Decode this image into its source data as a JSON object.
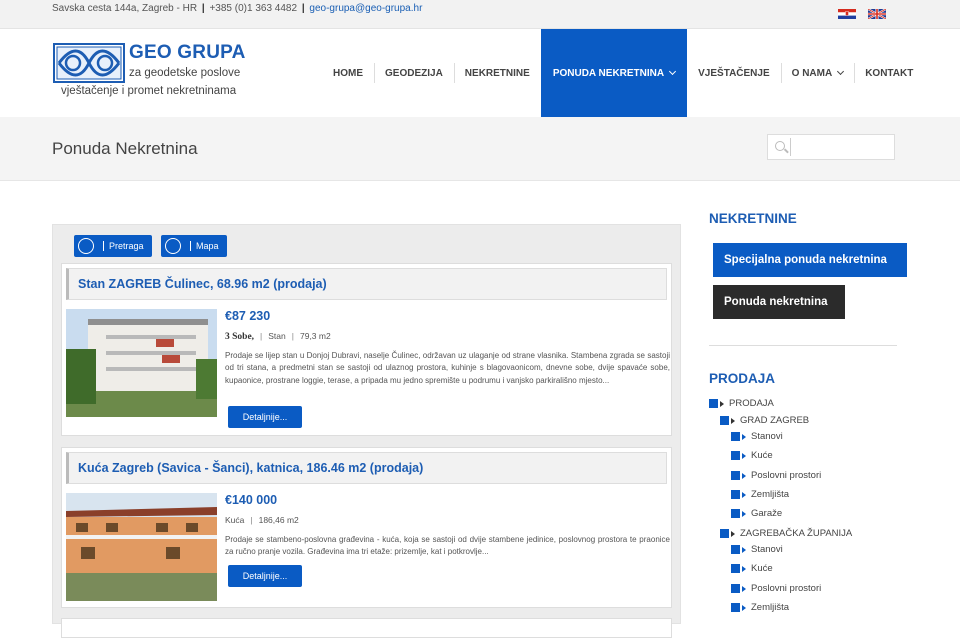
{
  "topbar": {
    "address": "Savska cesta 144a, Zagreb - HR",
    "phone": "+385 (0)1 363 4482",
    "email": "geo-grupa@geo-grupa.hr"
  },
  "logo": {
    "name": "GEO GRUPA",
    "tagline1": "za geodetske poslove",
    "tagline2": "vještačenje i promet nekretninama"
  },
  "nav": {
    "items": [
      {
        "label": "HOME"
      },
      {
        "label": "GEODEZIJA"
      },
      {
        "label": "NEKRETNINE"
      },
      {
        "label": "PONUDA NEKRETNINA"
      },
      {
        "label": "VJEŠTAČENJE"
      },
      {
        "label": "O NAMA"
      },
      {
        "label": "KONTAKT"
      }
    ]
  },
  "page": {
    "title": "Ponuda Nekretnina"
  },
  "search": {
    "placeholder": ""
  },
  "toolbar": {
    "search_label": "Pretraga",
    "map_label": "Mapa"
  },
  "listings": [
    {
      "title": "Stan ZAGREB Čulinec, 68.96 m2 (prodaja)",
      "price": "€87 230",
      "rooms": "3 Sobe,",
      "type": "Stan",
      "area": "79,3 m2",
      "description": "Prodaje se lijep stan u Donjoj Dubravi, naselje Čulinec, održavan uz ulaganje od strane vlasnika. Stambena zgrada se sastoji od tri stana, a predmetni stan se sastoji od ulaznog prostora, kuhinje s blagovaonicom, dnevne sobe, dvije spavaće sobe, kupaonice, prostrane loggie, terase, a pripada mu jedno spremište u podrumu i vanjsko parkirališno mjesto...",
      "button": "Detaljnije..."
    },
    {
      "title": "Kuća Zagreb (Savica - Šanci), katnica, 186.46 m2 (prodaja)",
      "price": "€140 000",
      "type": "Kuća",
      "area": "186,46 m2",
      "description": "Prodaje se stambeno-poslovna građevina - kuća, koja se sastoji od dvije stambene jedinice, poslovnog prostora te praonice za ručno pranje vozila. Građevina ima tri etaže: prizemlje, kat i potkrovlje...",
      "button": "Detaljnije..."
    }
  ],
  "sidebar": {
    "heading1": "NEKRETNINE",
    "btn_special": "Specijalna ponuda nekretnina",
    "btn_offer": "Ponuda nekretnina",
    "heading2": "PRODAJA",
    "tree": {
      "root": "PRODAJA",
      "group1": "GRAD ZAGREB",
      "group1_items": [
        "Stanovi",
        "Kuće",
        "Poslovni prostori",
        "Zemljišta",
        "Garaže"
      ],
      "group2": "ZAGREBAČKA ŽUPANIJA",
      "group2_items": [
        "Stanovi",
        "Kuće",
        "Poslovni prostori",
        "Zemljišta"
      ]
    }
  },
  "colors": {
    "accent": "#0a5bc4",
    "dark_button": "#2b2b2b",
    "title_blue": "#1d5db3"
  }
}
